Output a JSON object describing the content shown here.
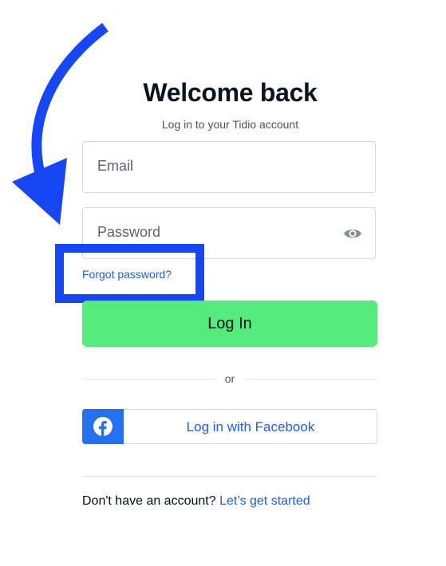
{
  "header": {
    "title": "Welcome back",
    "subtitle": "Log in to your Tidio account"
  },
  "form": {
    "email_placeholder": "Email",
    "password_placeholder": "Password",
    "forgot_label": "Forgot password?",
    "login_label": "Log In",
    "divider_label": "or",
    "facebook_label": "Log in with Facebook"
  },
  "footer": {
    "question": "Don't have an account?",
    "signup_link": "Let’s get started"
  },
  "icons": {
    "password_toggle": "eye-icon",
    "facebook": "facebook-icon",
    "annotation": "arrow-icon"
  },
  "colors": {
    "annotation_blue": "#1747f5",
    "login_green": "#55ea7c",
    "link_blue": "#1e5ee6",
    "facebook_blue": "#2470f0"
  }
}
